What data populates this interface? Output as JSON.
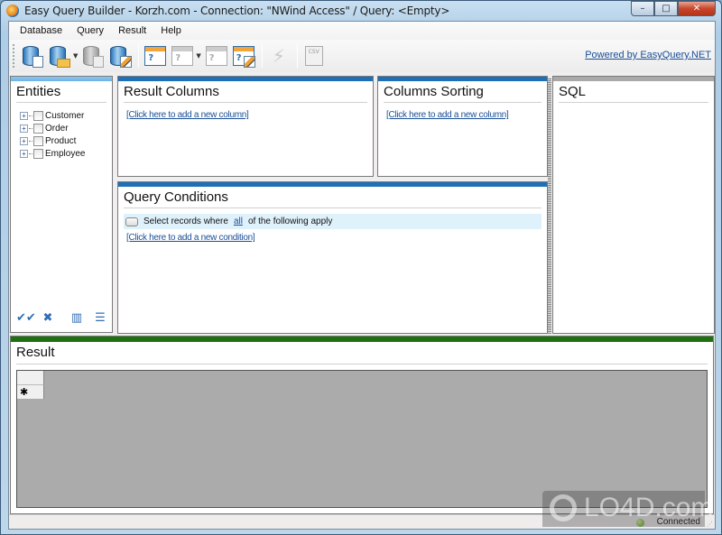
{
  "window": {
    "title": "Easy Query Builder - Korzh.com - Connection: \"NWind Access\" / Query: <Empty>",
    "controls": {
      "minimize": "–",
      "maximize": "□",
      "close": "✕"
    }
  },
  "menubar": {
    "items": [
      {
        "label": "Database"
      },
      {
        "label": "Query"
      },
      {
        "label": "Result"
      },
      {
        "label": "Help"
      }
    ]
  },
  "toolbar": {
    "buttons": [
      {
        "name": "new-connection",
        "icon": "database-new-icon",
        "enabled": true
      },
      {
        "name": "open-connection",
        "icon": "database-open-icon",
        "enabled": true,
        "dropdown": true
      },
      {
        "name": "save-connection",
        "icon": "database-save-icon",
        "enabled": false
      },
      {
        "name": "edit-connection",
        "icon": "database-edit-icon",
        "enabled": true
      },
      {
        "name": "new-query",
        "icon": "query-new-icon",
        "enabled": true
      },
      {
        "name": "open-query",
        "icon": "query-open-icon",
        "enabled": false,
        "dropdown": true
      },
      {
        "name": "save-query",
        "icon": "query-save-icon",
        "enabled": false
      },
      {
        "name": "edit-query",
        "icon": "query-edit-icon",
        "enabled": true
      },
      {
        "name": "execute",
        "icon": "lightning-icon",
        "enabled": false
      },
      {
        "name": "export-csv",
        "icon": "csv-export-icon",
        "enabled": false,
        "label": "CSV"
      }
    ],
    "powered_by": "Powered by EasyQuery.NET"
  },
  "entities": {
    "title": "Entities",
    "items": [
      {
        "label": "Customer",
        "checked": false
      },
      {
        "label": "Order",
        "checked": false
      },
      {
        "label": "Product",
        "checked": false
      },
      {
        "label": "Employee",
        "checked": false
      }
    ],
    "tools": [
      "check-all-icon",
      "uncheck-all-icon",
      "columns-view-icon",
      "list-view-icon"
    ]
  },
  "result_columns": {
    "title": "Result Columns",
    "add_link": "[Click here to add a new column]"
  },
  "columns_sorting": {
    "title": "Columns Sorting",
    "add_link": "[Click here to add a new column]"
  },
  "sql": {
    "title": "SQL",
    "text": ""
  },
  "query_conditions": {
    "title": "Query Conditions",
    "select_prefix": "Select records where",
    "select_mode": "all",
    "select_suffix": "of the following apply",
    "add_link": "[Click here to add a new condition]"
  },
  "result": {
    "title": "Result",
    "new_row_marker": "✱"
  },
  "statusbar": {
    "status": "Connected",
    "status_color": "#5aa31c"
  },
  "watermark": {
    "text": "LO4D.com"
  },
  "colors": {
    "panel_accent": "#1f6fb6",
    "result_accent": "#1f7010",
    "link": "#1a4f97",
    "condition_bg": "#dff1fb"
  }
}
